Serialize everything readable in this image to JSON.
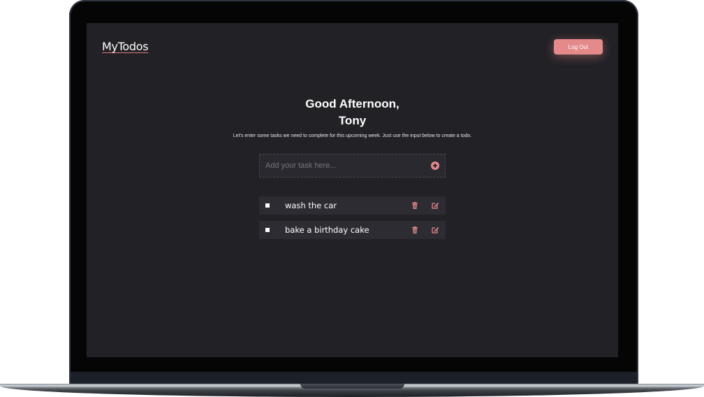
{
  "app": {
    "logo": "MyTodos",
    "logout_label": "Log Out",
    "accent_color": "#e58a8a"
  },
  "hero": {
    "greeting_line1": "Good Afternoon,",
    "greeting_line2": "Tony",
    "subtitle": "Let's enter some tasks we need to complete for this upcoming week. Just use the input below to create a todo."
  },
  "task_input": {
    "placeholder": "Add your task here...",
    "value": "",
    "add_icon": "plus-circle-icon"
  },
  "todos": [
    {
      "text": "wash the car",
      "checked": false
    },
    {
      "text": "bake a birthday cake",
      "checked": false
    }
  ]
}
